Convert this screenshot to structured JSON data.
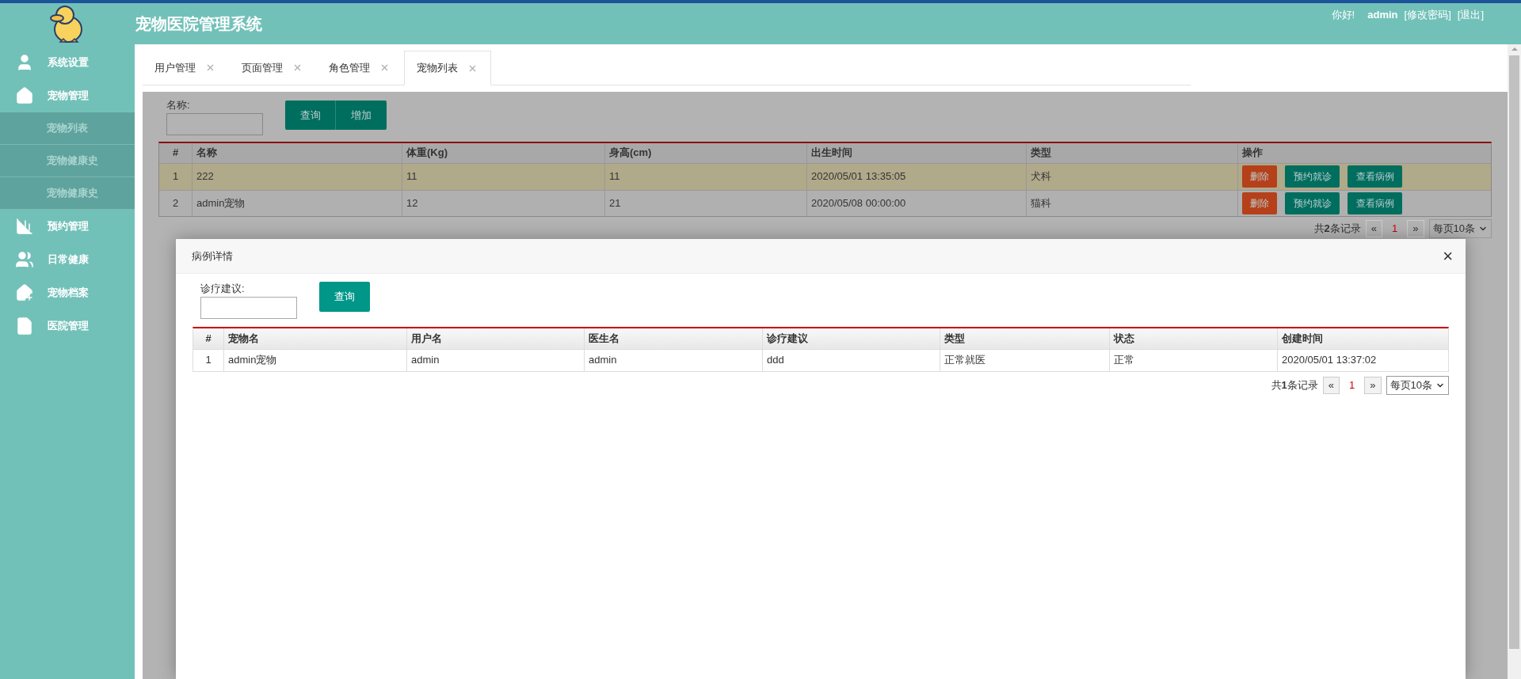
{
  "header": {
    "title": "宠物医院管理系统",
    "greeting": "你好!",
    "user": "admin",
    "links": [
      "[修改密码]",
      "[退出]"
    ]
  },
  "sidebar": {
    "items": [
      {
        "label": "系统设置"
      },
      {
        "label": "宠物管理",
        "expanded": true,
        "children": [
          {
            "label": "宠物列表"
          },
          {
            "label": "宠物健康史"
          },
          {
            "label": "宠物健康史"
          }
        ]
      },
      {
        "label": "预约管理"
      },
      {
        "label": "日常健康"
      },
      {
        "label": "宠物档案"
      },
      {
        "label": "医院管理"
      }
    ]
  },
  "tabs": [
    {
      "label": "用户管理",
      "selected": false
    },
    {
      "label": "页面管理",
      "selected": false
    },
    {
      "label": "角色管理",
      "selected": false
    },
    {
      "label": "宠物列表",
      "selected": true
    }
  ],
  "pet_list": {
    "search": {
      "label": "名称:",
      "buttons": [
        "查询",
        "增加"
      ]
    },
    "table": {
      "columns": [
        "#",
        "名称",
        "体重(Kg)",
        "身高(cm)",
        "出生时间",
        "类型",
        "操作"
      ],
      "rows": [
        {
          "selected": true,
          "cells": [
            "1",
            "222",
            "11",
            "11",
            "2020/05/01 13:35:05",
            "犬科"
          ],
          "actions": [
            {
              "label": "删除",
              "kind": "danger"
            },
            {
              "label": "预约就诊",
              "kind": "primary"
            },
            {
              "label": "查看病例",
              "kind": "primary"
            }
          ]
        },
        {
          "selected": false,
          "cells": [
            "2",
            "admin宠物",
            "12",
            "21",
            "2020/05/08 00:00:00",
            "猫科"
          ],
          "actions": [
            {
              "label": "删除",
              "kind": "danger"
            },
            {
              "label": "预约就诊",
              "kind": "primary"
            },
            {
              "label": "查看病例",
              "kind": "primary"
            }
          ]
        }
      ]
    },
    "pager": {
      "total": "共**2**条记录",
      "prev": "«",
      "page": "1",
      "next": "»",
      "page_size": "每页10条"
    }
  },
  "modal": {
    "title": "病例详情",
    "close": "×",
    "search": {
      "label": "诊疗建议:",
      "button": "查询"
    },
    "table": {
      "columns": [
        "#",
        "宠物名",
        "用户名",
        "医生名",
        "诊疗建议",
        "类型",
        "状态",
        "创建时间"
      ],
      "rows": [
        [
          "1",
          "admin宠物",
          "admin",
          "admin",
          "ddd",
          "正常就医",
          "正常",
          "2020/05/01 13:37:02"
        ]
      ]
    },
    "pager": {
      "total": "共**1**条记录",
      "prev": "«",
      "page": "1",
      "next": "»",
      "page_size": "每页10条"
    }
  }
}
